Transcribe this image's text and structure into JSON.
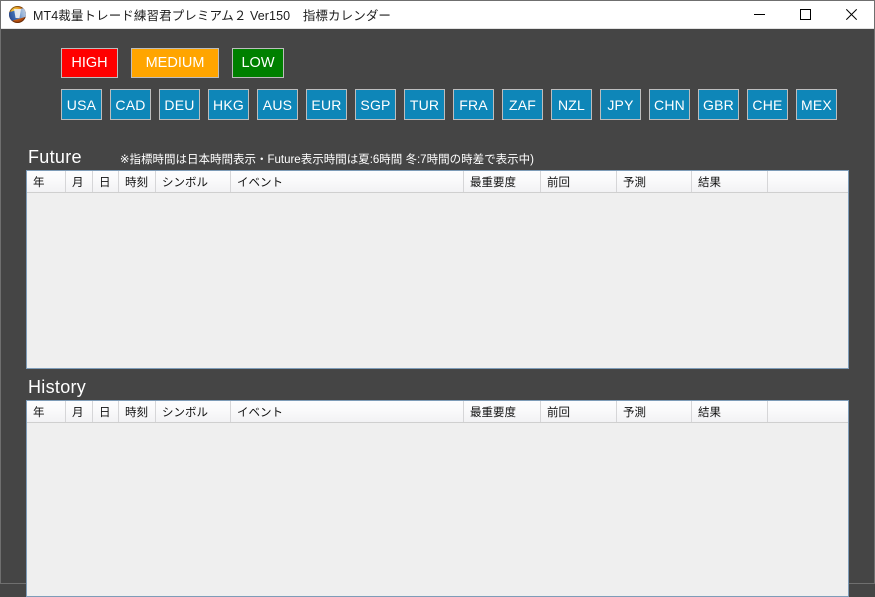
{
  "window": {
    "title": "MT4裁量トレード練習君プレミアム２ Ver150　指標カレンダー",
    "icon": "app-logo-icon",
    "background_color": "#454545",
    "controls": {
      "minimize_label": "—",
      "maximize_label": "□",
      "close_label": "✕"
    }
  },
  "importance_filters": [
    {
      "label": "HIGH",
      "color": "#ff0000"
    },
    {
      "label": "MEDIUM",
      "color": "#ffa500"
    },
    {
      "label": "LOW",
      "color": "#008000"
    }
  ],
  "country_filters": [
    {
      "label": "USA",
      "color": "#0e86b8"
    },
    {
      "label": "CAD",
      "color": "#0e86b8"
    },
    {
      "label": "DEU",
      "color": "#0e86b8"
    },
    {
      "label": "HKG",
      "color": "#0e86b8"
    },
    {
      "label": "AUS",
      "color": "#0e86b8"
    },
    {
      "label": "EUR",
      "color": "#0e86b8"
    },
    {
      "label": "SGP",
      "color": "#0e86b8"
    },
    {
      "label": "TUR",
      "color": "#0e86b8"
    },
    {
      "label": "FRA",
      "color": "#0e86b8"
    },
    {
      "label": "ZAF",
      "color": "#0e86b8"
    },
    {
      "label": "NZL",
      "color": "#0e86b8"
    },
    {
      "label": "JPY",
      "color": "#0e86b8"
    },
    {
      "label": "CHN",
      "color": "#0e86b8"
    },
    {
      "label": "GBR",
      "color": "#0e86b8"
    },
    {
      "label": "CHE",
      "color": "#0e86b8"
    },
    {
      "label": "MEX",
      "color": "#0e86b8"
    }
  ],
  "future_section": {
    "title": "Future",
    "note": "※指標時間は日本時間表示・Future表示時間は夏:6時間 冬:7時間の時差で表示中)",
    "columns": [
      "年",
      "月",
      "日",
      "時刻",
      "シンボル",
      "イベント",
      "最重要度",
      "前回",
      "予測",
      "結果",
      ""
    ],
    "rows": []
  },
  "history_section": {
    "title": "History",
    "columns": [
      "年",
      "月",
      "日",
      "時刻",
      "シンボル",
      "イベント",
      "最重要度",
      "前回",
      "予測",
      "結果",
      ""
    ],
    "rows": []
  }
}
